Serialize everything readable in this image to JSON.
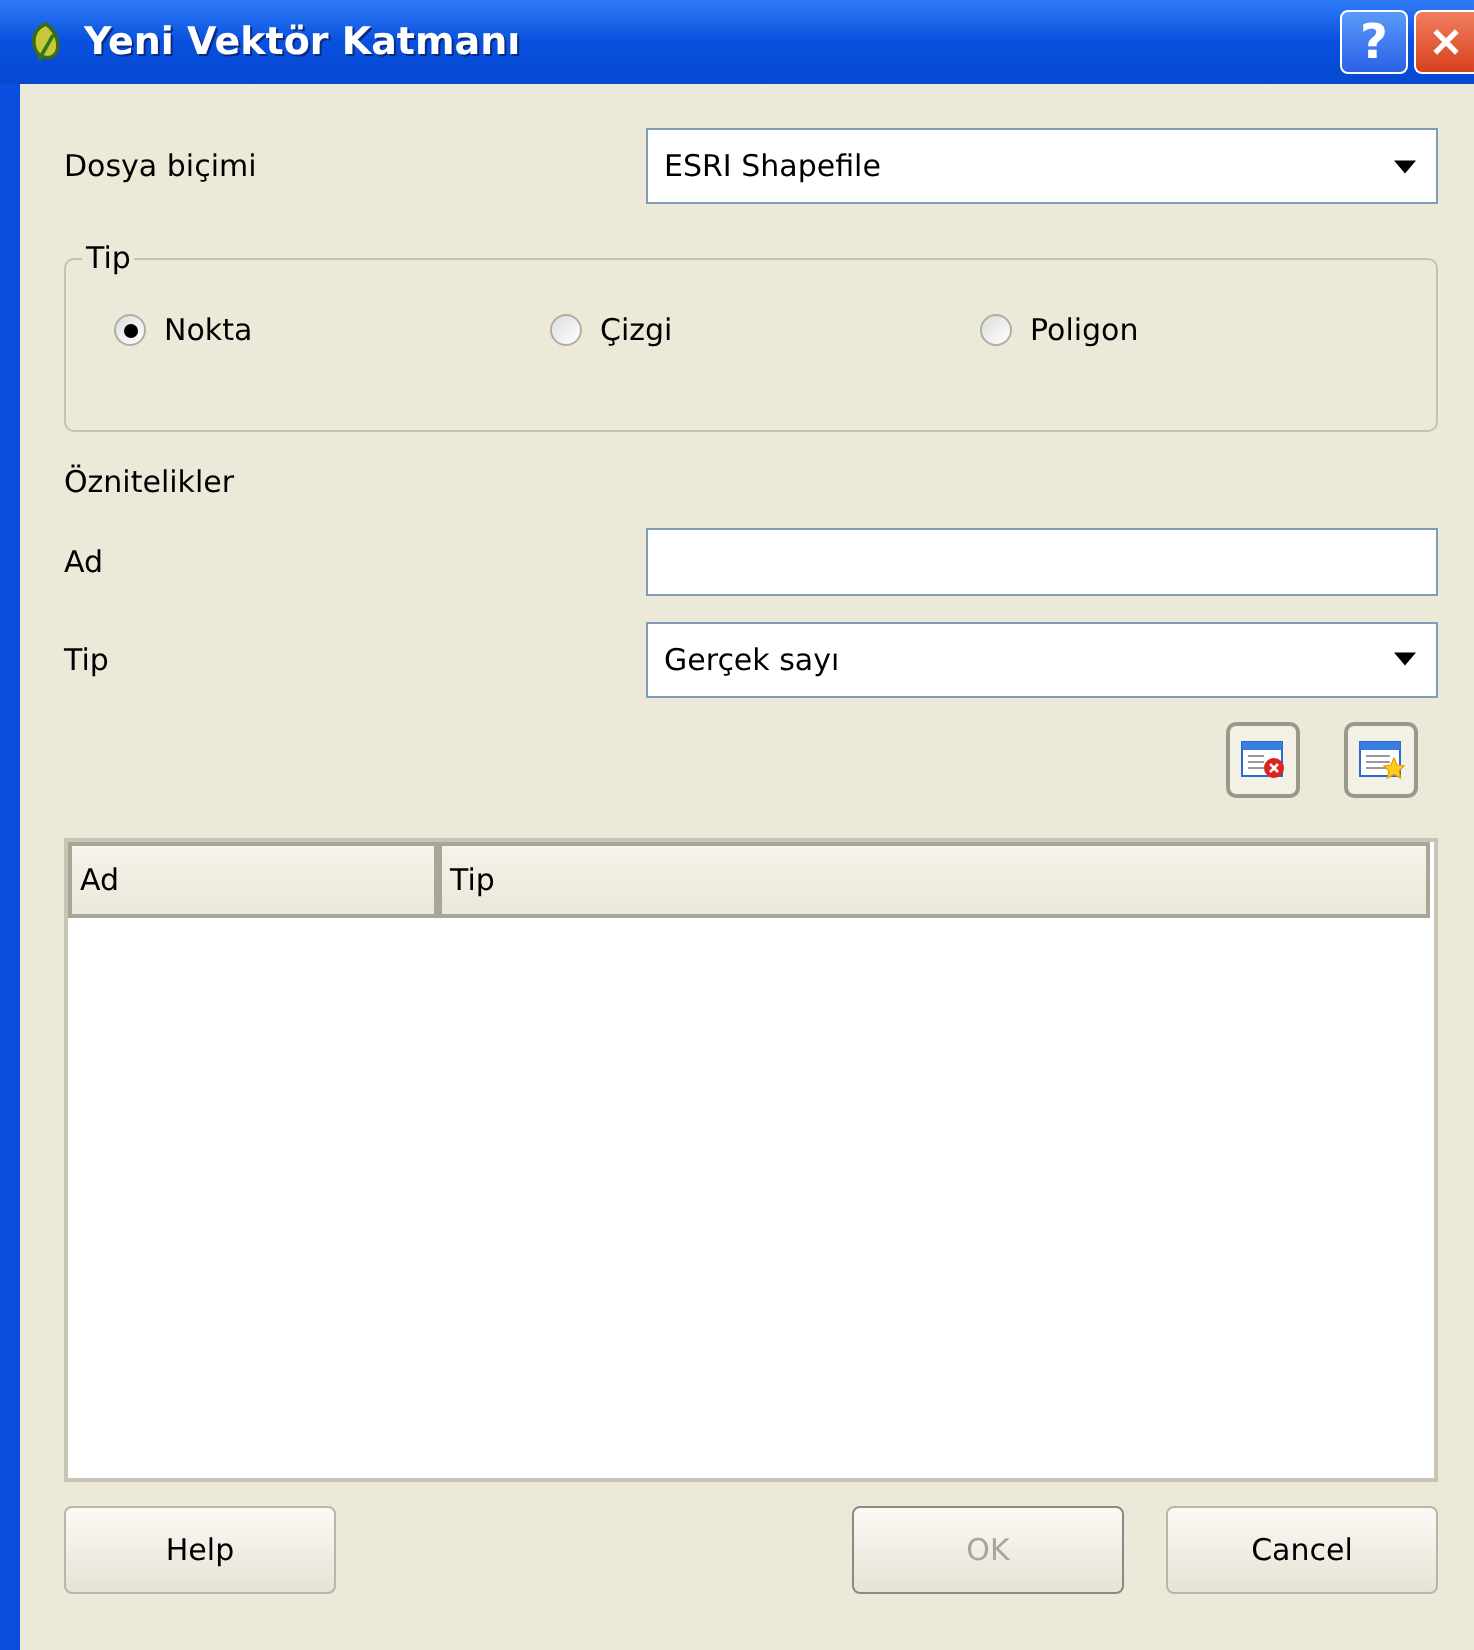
{
  "window": {
    "title": "Yeni Vektör Katmanı",
    "help_button": "?"
  },
  "file_format": {
    "label": "Dosya biçimi",
    "value": "ESRI Shapefile"
  },
  "type_group": {
    "title": "Tip",
    "options": [
      {
        "label": "Nokta",
        "selected": true
      },
      {
        "label": "Çizgi",
        "selected": false
      },
      {
        "label": "Poligon",
        "selected": false
      }
    ]
  },
  "attributes": {
    "title": "Öznitelikler",
    "name_label": "Ad",
    "type_label": "Tip",
    "type_value": "Gerçek sayı"
  },
  "table": {
    "columns": [
      "Ad",
      "Tip"
    ]
  },
  "buttons": [
    {
      "label": "Help",
      "disabled": false
    },
    {
      "label": "OK",
      "disabled": true
    },
    {
      "label": "Cancel",
      "disabled": false
    }
  ]
}
